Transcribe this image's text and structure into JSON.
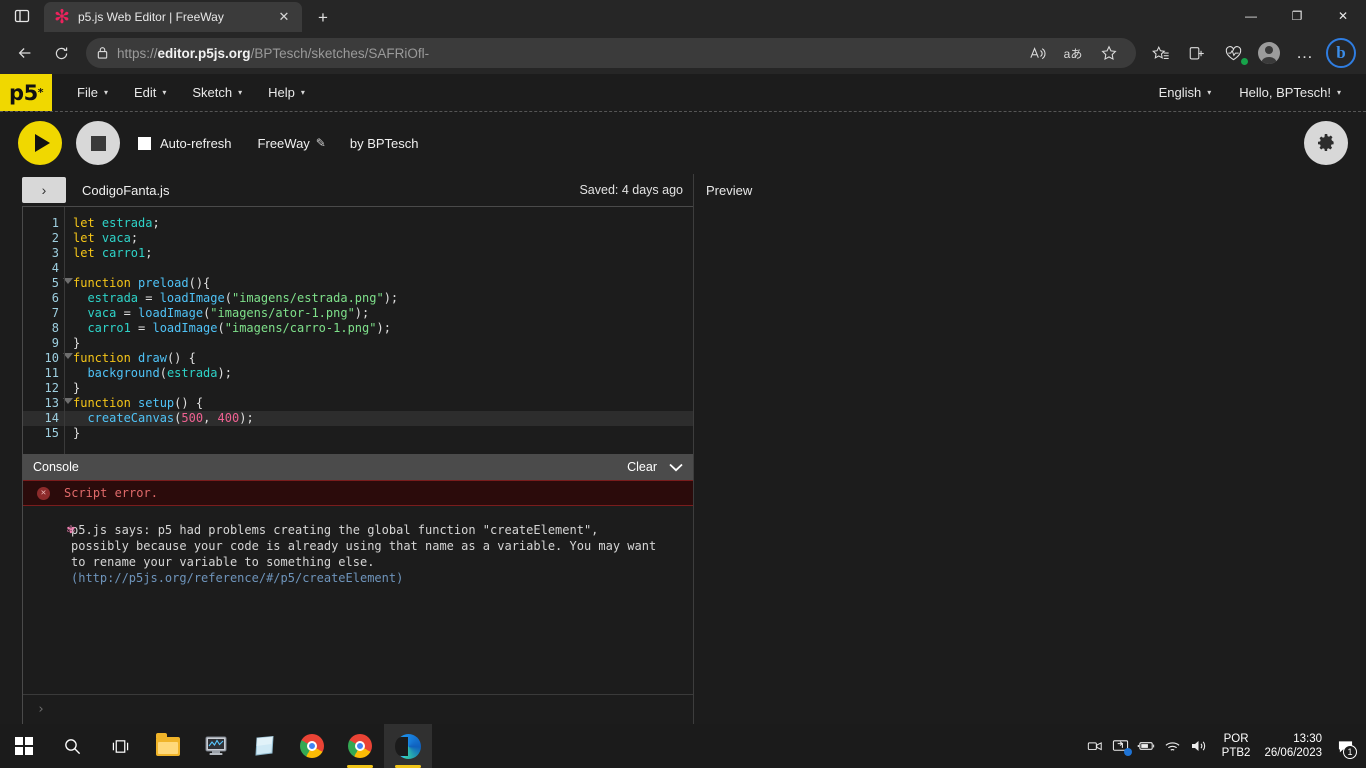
{
  "browser": {
    "tab": {
      "title": "p5.js Web Editor | FreeWay",
      "favicon": "p5-asterisk-icon",
      "close_label": "✕"
    },
    "new_tab_label": "+",
    "tab_list_icon": "tab-list-icon",
    "window_controls": {
      "minimize": "—",
      "maximize": "❐",
      "close": "✕"
    },
    "nav": {
      "back_label": "←",
      "refresh_label": "⟳",
      "lock_icon": "lock-icon",
      "url_scheme": "https://",
      "url_host": "editor.p5js.org",
      "url_path": "/BPTesch/sketches/SAFRiOfl-",
      "read_aloud_label": "A",
      "translate_label": "aあ",
      "favorite_label": "☆",
      "collections_label": "collections-icon",
      "split_screen_label": "split-screen-icon",
      "browser_essentials_label": "browser-essentials-icon",
      "profile_label": "profile-avatar",
      "settings_more_label": "…",
      "copilot_label": "b"
    }
  },
  "p5": {
    "logo": "p5",
    "logo_sup": "*",
    "menu": [
      {
        "label": "File",
        "caret": "▾"
      },
      {
        "label": "Edit",
        "caret": "▾"
      },
      {
        "label": "Sketch",
        "caret": "▾"
      },
      {
        "label": "Help",
        "caret": "▾"
      }
    ],
    "nav_right": [
      {
        "label": "English",
        "caret": "▾"
      },
      {
        "label": "Hello, BPTesch!",
        "caret": "▾"
      }
    ],
    "toolbar": {
      "play_label": "play-button",
      "stop_label": "stop-button",
      "auto_refresh_label": "Auto-refresh",
      "auto_refresh_checked": false,
      "sketch_name": "FreeWay",
      "rename_icon": "pencil-icon",
      "author": "by BPTesch",
      "settings_icon": "gear-icon"
    },
    "editor": {
      "sidebar_toggle": "›",
      "filename": "CodigoFanta.js",
      "saved_status": "Saved: 4 days ago",
      "preview_label": "Preview",
      "lines": [
        {
          "n": 1,
          "fold": false,
          "active": false,
          "tokens": [
            {
              "t": "let ",
              "c": "kw"
            },
            {
              "t": "estrada",
              "c": "var"
            },
            {
              "t": ";",
              "c": "pun"
            }
          ]
        },
        {
          "n": 2,
          "fold": false,
          "active": false,
          "tokens": [
            {
              "t": "let ",
              "c": "kw"
            },
            {
              "t": "vaca",
              "c": "var"
            },
            {
              "t": ";",
              "c": "pun"
            }
          ]
        },
        {
          "n": 3,
          "fold": false,
          "active": false,
          "tokens": [
            {
              "t": "let ",
              "c": "kw"
            },
            {
              "t": "carro1",
              "c": "var"
            },
            {
              "t": ";",
              "c": "pun"
            }
          ]
        },
        {
          "n": 4,
          "fold": false,
          "active": false,
          "tokens": []
        },
        {
          "n": 5,
          "fold": true,
          "active": false,
          "tokens": [
            {
              "t": "function ",
              "c": "kw"
            },
            {
              "t": "preload",
              "c": "call"
            },
            {
              "t": "(){",
              "c": "pun"
            }
          ]
        },
        {
          "n": 6,
          "fold": false,
          "active": false,
          "tokens": [
            {
              "t": "  estrada ",
              "c": "var"
            },
            {
              "t": "= ",
              "c": "pun"
            },
            {
              "t": "loadImage",
              "c": "call"
            },
            {
              "t": "(",
              "c": "pun"
            },
            {
              "t": "\"imagens/estrada.png\"",
              "c": "str"
            },
            {
              "t": ");",
              "c": "pun"
            }
          ]
        },
        {
          "n": 7,
          "fold": false,
          "active": false,
          "tokens": [
            {
              "t": "  vaca ",
              "c": "var"
            },
            {
              "t": "= ",
              "c": "pun"
            },
            {
              "t": "loadImage",
              "c": "call"
            },
            {
              "t": "(",
              "c": "pun"
            },
            {
              "t": "\"imagens/ator-1.png\"",
              "c": "str"
            },
            {
              "t": ");",
              "c": "pun"
            }
          ]
        },
        {
          "n": 8,
          "fold": false,
          "active": false,
          "tokens": [
            {
              "t": "  carro1 ",
              "c": "var"
            },
            {
              "t": "= ",
              "c": "pun"
            },
            {
              "t": "loadImage",
              "c": "call"
            },
            {
              "t": "(",
              "c": "pun"
            },
            {
              "t": "\"imagens/carro-1.png\"",
              "c": "str"
            },
            {
              "t": ");",
              "c": "pun"
            }
          ]
        },
        {
          "n": 9,
          "fold": false,
          "active": false,
          "tokens": [
            {
              "t": "}",
              "c": "pun"
            }
          ]
        },
        {
          "n": 10,
          "fold": true,
          "active": false,
          "tokens": [
            {
              "t": "function ",
              "c": "kw"
            },
            {
              "t": "draw",
              "c": "call"
            },
            {
              "t": "() {",
              "c": "pun"
            }
          ]
        },
        {
          "n": 11,
          "fold": false,
          "active": false,
          "tokens": [
            {
              "t": "  ",
              "c": "pun"
            },
            {
              "t": "background",
              "c": "call"
            },
            {
              "t": "(",
              "c": "pun"
            },
            {
              "t": "estrada",
              "c": "var"
            },
            {
              "t": ");",
              "c": "pun"
            }
          ]
        },
        {
          "n": 12,
          "fold": false,
          "active": false,
          "tokens": [
            {
              "t": "}",
              "c": "pun"
            }
          ]
        },
        {
          "n": 13,
          "fold": true,
          "active": false,
          "tokens": [
            {
              "t": "function ",
              "c": "kw"
            },
            {
              "t": "setup",
              "c": "call"
            },
            {
              "t": "() {",
              "c": "pun"
            }
          ]
        },
        {
          "n": 14,
          "fold": false,
          "active": true,
          "tokens": [
            {
              "t": "  ",
              "c": "pun"
            },
            {
              "t": "createCanvas",
              "c": "call"
            },
            {
              "t": "(",
              "c": "pun"
            },
            {
              "t": "500",
              "c": "num"
            },
            {
              "t": ", ",
              "c": "pun"
            },
            {
              "t": "400",
              "c": "num"
            },
            {
              "t": ");",
              "c": "pun"
            }
          ]
        },
        {
          "n": 15,
          "fold": false,
          "active": false,
          "tokens": [
            {
              "t": "}",
              "c": "pun"
            }
          ]
        }
      ]
    },
    "console": {
      "title": "Console",
      "clear_label": "Clear",
      "collapse_icon": "chevron-down-icon",
      "error_icon": "error-circle-icon",
      "error_text": "Script error.",
      "message_icon": "p5-flower-icon",
      "message_text": "p5.js says: p5 had problems creating the global function \"createElement\", possibly because your code is already using that name as a variable. You may want to rename your variable to something else. ",
      "message_link": "(http://p5js.org/reference/#/p5/createElement)",
      "prompt_symbol": "›"
    }
  },
  "taskbar": {
    "items": [
      {
        "name": "start-button",
        "icon": "windows-logo-icon",
        "active": false,
        "underline": "none"
      },
      {
        "name": "search-button",
        "icon": "search-icon",
        "active": false,
        "underline": "none"
      },
      {
        "name": "task-view-button",
        "icon": "task-view-icon",
        "active": false,
        "underline": "none"
      },
      {
        "name": "file-explorer",
        "icon": "folder-icon",
        "active": false,
        "underline": "none"
      },
      {
        "name": "scratch-app",
        "icon": "monitor-icon",
        "active": false,
        "underline": "none"
      },
      {
        "name": "notepad-app",
        "icon": "notepad-icon",
        "active": false,
        "underline": "none"
      },
      {
        "name": "chrome-window-1",
        "icon": "chrome-icon",
        "active": false,
        "underline": "none"
      },
      {
        "name": "chrome-window-2",
        "icon": "chrome-icon",
        "active": false,
        "underline": "yellow"
      },
      {
        "name": "edge-window",
        "icon": "edge-icon",
        "active": true,
        "underline": "yellow"
      }
    ],
    "tray": {
      "icons": [
        "camera-icon",
        "screen-cast-icon",
        "battery-icon",
        "wifi-icon",
        "volume-icon"
      ],
      "language_top": "POR",
      "language_bottom": "PTB2",
      "time": "13:30",
      "date": "26/06/2023",
      "notifications_icon": "notifications-icon",
      "notifications_count": "1"
    }
  }
}
